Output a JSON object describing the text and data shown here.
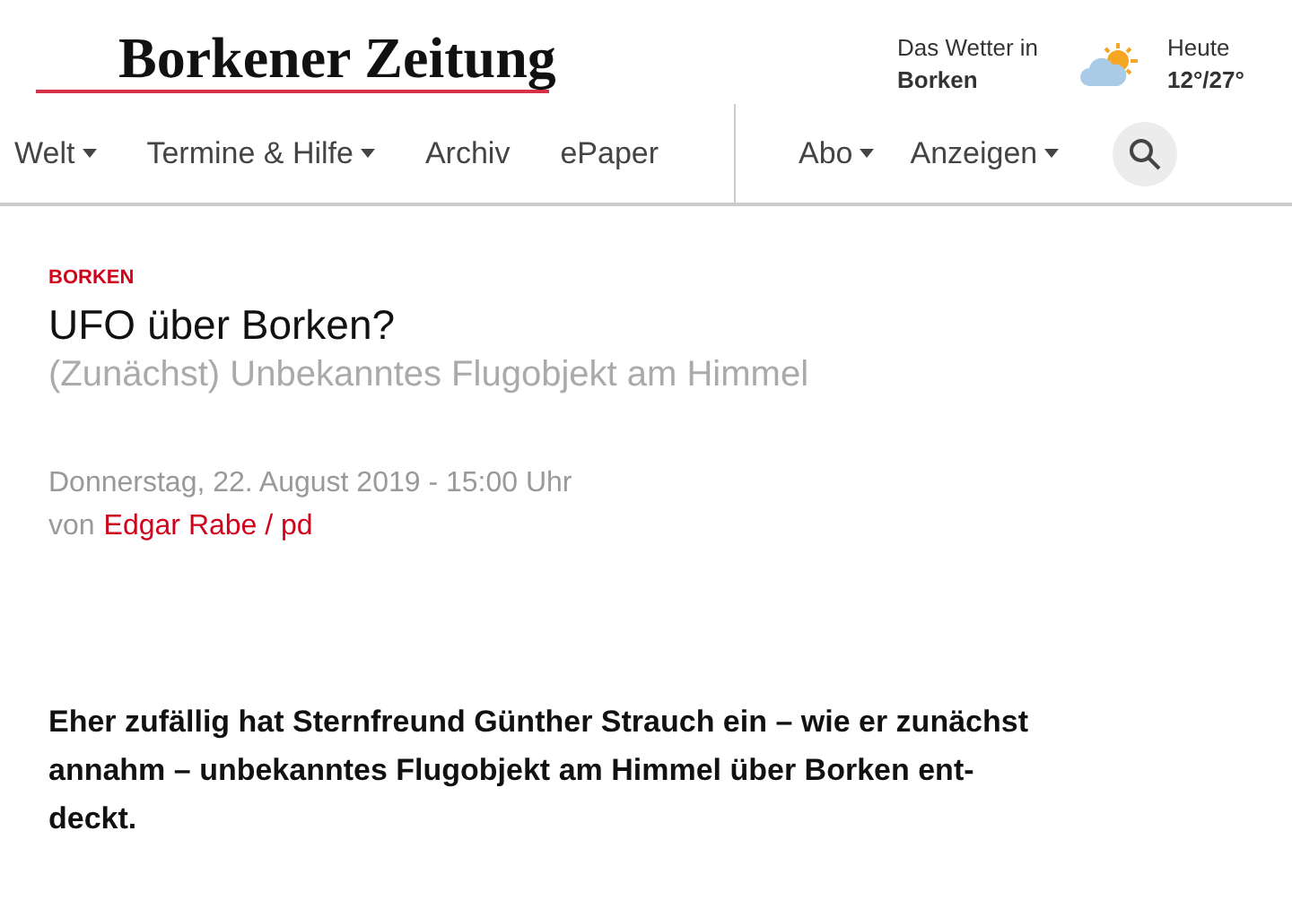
{
  "logo": "Borkener Zeitung",
  "weather": {
    "caption": "Das Wetter in",
    "place": "Borken",
    "day": "Heute",
    "temperature": "12°/27°"
  },
  "nav_left": [
    {
      "label": "Welt",
      "dropdown": true
    },
    {
      "label": "Termine & Hilfe",
      "dropdown": true
    },
    {
      "label": "Archiv",
      "dropdown": false
    },
    {
      "label": "ePaper",
      "dropdown": false
    }
  ],
  "nav_right": [
    {
      "label": "Abo",
      "dropdown": true
    },
    {
      "label": "Anzeigen",
      "dropdown": true
    }
  ],
  "article": {
    "section": "BORKEN",
    "title": "UFO über Borken?",
    "subtitle": "(Zunächst) Unbekanntes Flugobjekt am Himmel",
    "date": "Donnerstag, 22. August 2019 - 15:00 Uhr",
    "byline_prefix": "von",
    "author": "Edgar Rabe / pd",
    "lead": "Eher zufällig hat Sternfreund Günther Strauch ein – wie er zunächst annahm – unbekanntes Flugobjekt am Himmel über Borken ent-\ndeckt."
  }
}
